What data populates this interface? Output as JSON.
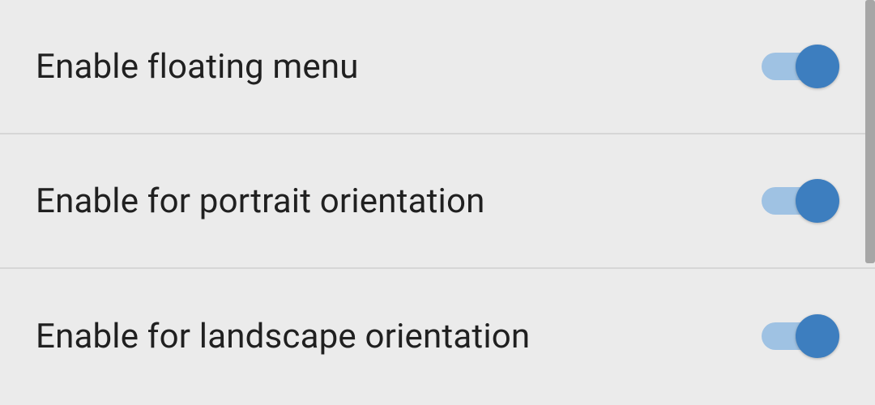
{
  "settings": [
    {
      "label": "Enable floating menu",
      "enabled": true
    },
    {
      "label": "Enable for portrait orientation",
      "enabled": true
    },
    {
      "label": "Enable for landscape orientation",
      "enabled": true
    }
  ],
  "colors": {
    "background": "#ebebeb",
    "divider": "#d6d6d6",
    "text": "#202020",
    "toggle_track_on": "#9fc2e3",
    "toggle_thumb_on": "#3d7ebf",
    "scrollbar": "#a6a6a6"
  }
}
